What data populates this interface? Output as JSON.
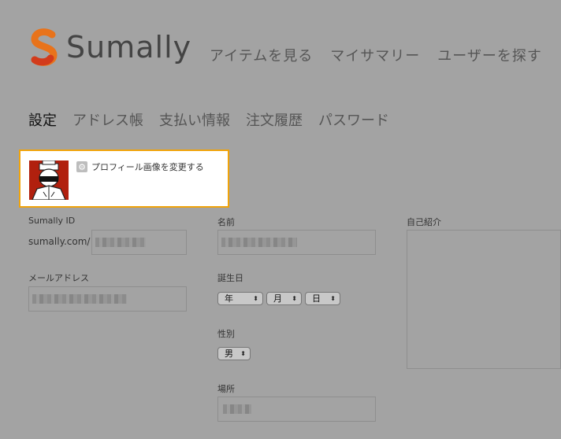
{
  "brand": {
    "name": "Sumally"
  },
  "main_nav": [
    "アイテムを見る",
    "マイサマリー",
    "ユーザーを探す"
  ],
  "settings_tabs": [
    {
      "label": "設定",
      "active": true
    },
    {
      "label": "アドレス帳",
      "active": false
    },
    {
      "label": "支払い情報",
      "active": false
    },
    {
      "label": "注文履歴",
      "active": false
    },
    {
      "label": "パスワード",
      "active": false
    }
  ],
  "profile": {
    "change_image_label": "プロフィール画像を変更する"
  },
  "form": {
    "sumally_id": {
      "label": "Sumally ID",
      "prefix": "sumally.com/"
    },
    "email": {
      "label": "メールアドレス"
    },
    "name": {
      "label": "名前"
    },
    "birthday": {
      "label": "誕生日",
      "year": "年",
      "month": "月",
      "day": "日"
    },
    "gender": {
      "label": "性別",
      "value": "男"
    },
    "location": {
      "label": "場所"
    },
    "bio": {
      "label": "自己紹介"
    }
  },
  "colors": {
    "accent_border": "#f0a30a",
    "overlay": "#a3a3a3",
    "logo_orange": "#e8731b",
    "logo_red": "#d23b1c"
  }
}
